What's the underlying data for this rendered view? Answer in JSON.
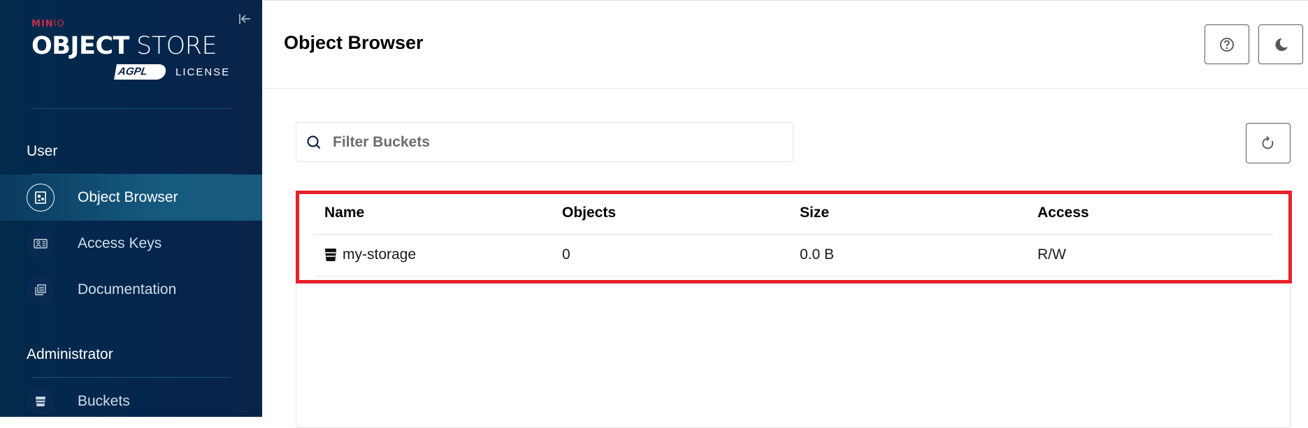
{
  "sidebar": {
    "brand": {
      "minio_bold": "MIN",
      "minio_light": "IO",
      "product_bold": "OBJECT",
      "product_light": "STORE",
      "license_badge": "AGPL",
      "license_label": "LICENSE"
    },
    "collapse_icon": "collapse-left-icon",
    "sections": [
      {
        "title": "User",
        "items": [
          {
            "label": "Object Browser",
            "icon": "object-browser-icon",
            "active": true
          },
          {
            "label": "Access Keys",
            "icon": "access-keys-icon",
            "active": false
          },
          {
            "label": "Documentation",
            "icon": "documentation-icon",
            "active": false
          }
        ]
      },
      {
        "title": "Administrator",
        "items": [
          {
            "label": "Buckets",
            "icon": "bucket-icon",
            "active": false
          }
        ]
      }
    ]
  },
  "header": {
    "title": "Object Browser",
    "help_icon": "help-icon",
    "theme_icon": "moon-icon"
  },
  "search": {
    "placeholder": "Filter Buckets",
    "value": ""
  },
  "refresh_icon": "refresh-icon",
  "table": {
    "columns": [
      "Name",
      "Objects",
      "Size",
      "Access"
    ],
    "rows": [
      {
        "name": "my-storage",
        "objects": "0",
        "size": "0.0 B",
        "access": "R/W"
      }
    ]
  },
  "colors": {
    "highlight": "#e8202a",
    "brand_red": "#c72c48",
    "sidebar_bg": "#0b2349",
    "active_item": "#155a7f"
  }
}
